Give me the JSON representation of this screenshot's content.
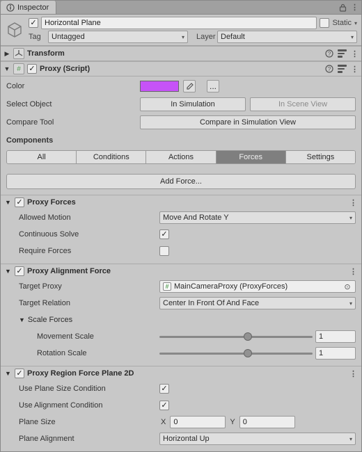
{
  "tab": {
    "title": "Inspector"
  },
  "header": {
    "enabled_checked": true,
    "name": "Horizontal Plane",
    "static_label": "Static",
    "static_checked": false,
    "tag_label": "Tag",
    "tag_value": "Untagged",
    "layer_label": "Layer",
    "layer_value": "Default"
  },
  "transform": {
    "title": "Transform"
  },
  "proxy": {
    "title": "Proxy (Script)",
    "enabled": true,
    "color_label": "Color",
    "color_hex": "#c653f7",
    "open_picker": "...",
    "select_object_label": "Select Object",
    "in_simulation": "In Simulation",
    "in_scene_view": "In Scene View",
    "compare_tool_label": "Compare Tool",
    "compare_btn": "Compare in Simulation View",
    "components_label": "Components",
    "tabs": [
      "All",
      "Conditions",
      "Actions",
      "Forces",
      "Settings"
    ],
    "active_tab_index": 3,
    "add_force": "Add Force..."
  },
  "proxy_forces": {
    "title": "Proxy Forces",
    "enabled": true,
    "allowed_motion_label": "Allowed Motion",
    "allowed_motion_value": "Move And Rotate Y",
    "continuous_solve_label": "Continuous Solve",
    "continuous_solve_checked": true,
    "require_forces_label": "Require Forces",
    "require_forces_checked": false
  },
  "proxy_alignment": {
    "title": "Proxy Alignment Force",
    "enabled": true,
    "target_proxy_label": "Target Proxy",
    "target_proxy_value": "MainCameraProxy (ProxyForces)",
    "target_relation_label": "Target Relation",
    "target_relation_value": "Center In Front Of And Face",
    "scale_forces_label": "Scale Forces",
    "movement_scale_label": "Movement Scale",
    "movement_scale_value": "1",
    "rotation_scale_label": "Rotation Scale",
    "rotation_scale_value": "1"
  },
  "proxy_region": {
    "title": "Proxy Region Force Plane 2D",
    "enabled": true,
    "use_plane_size_label": "Use Plane Size Condition",
    "use_plane_size_checked": true,
    "use_alignment_label": "Use Alignment Condition",
    "use_alignment_checked": true,
    "plane_size_label": "Plane Size",
    "plane_size_x": "0",
    "plane_size_y": "0",
    "plane_alignment_label": "Plane Alignment",
    "plane_alignment_value": "Horizontal Up"
  }
}
